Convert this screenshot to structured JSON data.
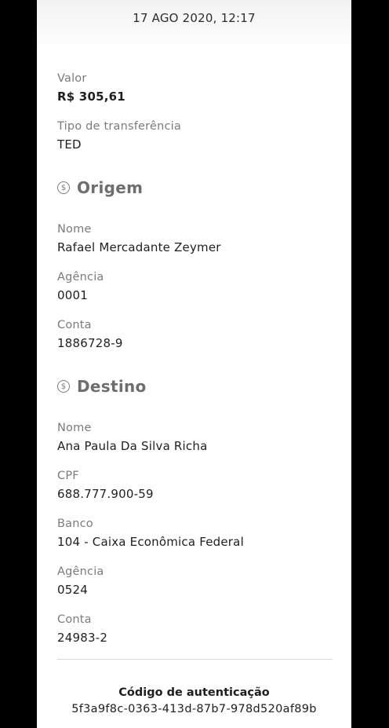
{
  "header": {
    "date": "17 AGO 2020, 12:17"
  },
  "summary": {
    "valor_label": "Valor",
    "valor_value": "R$ 305,61",
    "tipo_label": "Tipo de transferência",
    "tipo_value": "TED"
  },
  "origem": {
    "icon": "dollar-circle-icon",
    "title": "Origem",
    "nome_label": "Nome",
    "nome_value": "Rafael Mercadante Zeymer",
    "agencia_label": "Agência",
    "agencia_value": "0001",
    "conta_label": "Conta",
    "conta_value": "1886728-9"
  },
  "destino": {
    "icon": "dollar-circle-icon",
    "title": "Destino",
    "nome_label": "Nome",
    "nome_value": "Ana Paula Da Silva Richa",
    "cpf_label": "CPF",
    "cpf_value": "688.777.900-59",
    "banco_label": "Banco",
    "banco_value": "104 - Caixa Econômica Federal",
    "agencia_label": "Agência",
    "agencia_value": "0524",
    "conta_label": "Conta",
    "conta_value": "24983-2"
  },
  "auth": {
    "title": "Código de autenticação",
    "code": "5f3a9f8c-0363-413d-87b7-978d520af89b"
  },
  "icon_glyph": "$"
}
